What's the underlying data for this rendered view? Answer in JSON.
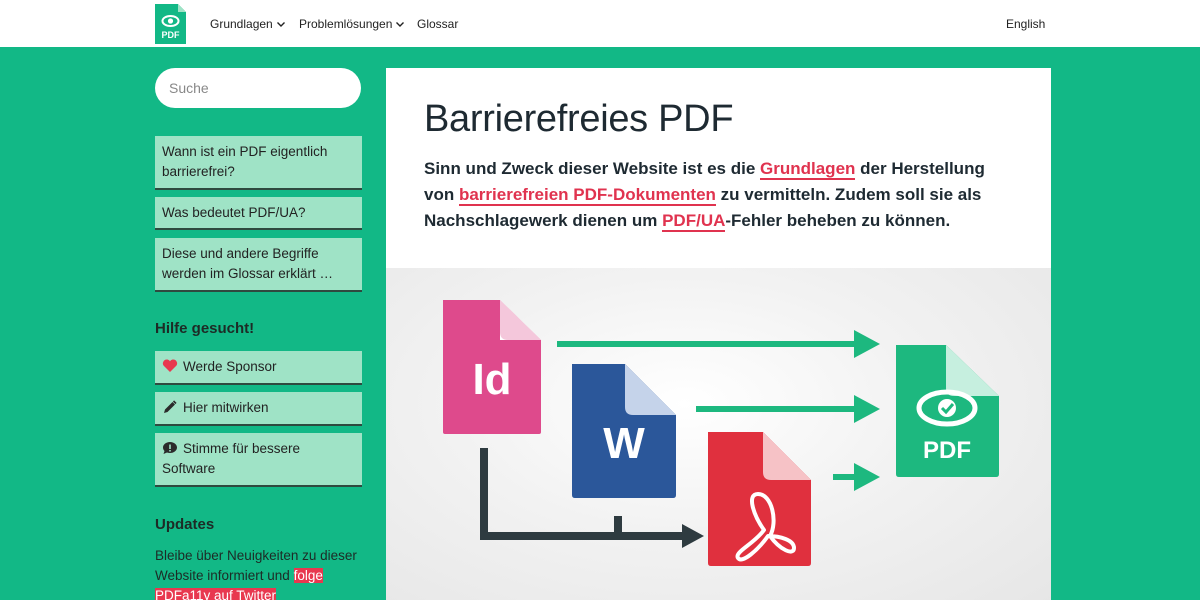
{
  "nav": {
    "logo_text": "PDF",
    "items": [
      {
        "label": "Grundlagen"
      },
      {
        "label": "Problemlösungen"
      },
      {
        "label": "Glossar"
      }
    ],
    "language": "English"
  },
  "sidebar": {
    "search_placeholder": "Suche",
    "links": [
      {
        "label": "Wann ist ein PDF eigentlich barrierefrei?"
      },
      {
        "label": "Was bedeutet PDF/UA?"
      },
      {
        "label": "Diese und andere Begriffe werden im Glossar erklärt …"
      }
    ],
    "help_heading": "Hilfe gesucht!",
    "help_links": [
      {
        "label": "Werde Sponsor",
        "icon": "heart-icon"
      },
      {
        "label": "Hier mitwirken",
        "icon": "pen-icon"
      },
      {
        "label": "Stimme für bessere Software",
        "icon": "comment-icon"
      }
    ],
    "updates_heading": "Updates",
    "updates_text": "Bleibe über Neuigkeiten zu dieser Website informiert und ",
    "updates_link": "folge PDFa11y auf Twitter"
  },
  "main": {
    "title": "Barrierefreies PDF",
    "intro": {
      "part1": "Sinn und Zweck dieser Website ist es die ",
      "link1": "Grundlagen",
      "part2": " der Herstellung von ",
      "link2": "barrierefreien PDF-Dokumenten",
      "part3": " zu vermitteln. Zudem soll sie als Nachschlagewerk dienen um ",
      "link3": "PDF/UA",
      "part4": "-Fehler beheben zu können."
    },
    "illustration": {
      "indesign_label": "Id",
      "word_label": "W",
      "pdf_label": "PDF"
    }
  },
  "colors": {
    "brand_green": "#12b886",
    "sidebar_item": "#9fe3c6",
    "link_red": "#e0334f",
    "indesign_pink": "#de4a8c",
    "word_blue": "#2b579a",
    "acrobat_red": "#e0303e",
    "arrow_green": "#1db87f",
    "arrow_dark": "#2e3b40"
  }
}
